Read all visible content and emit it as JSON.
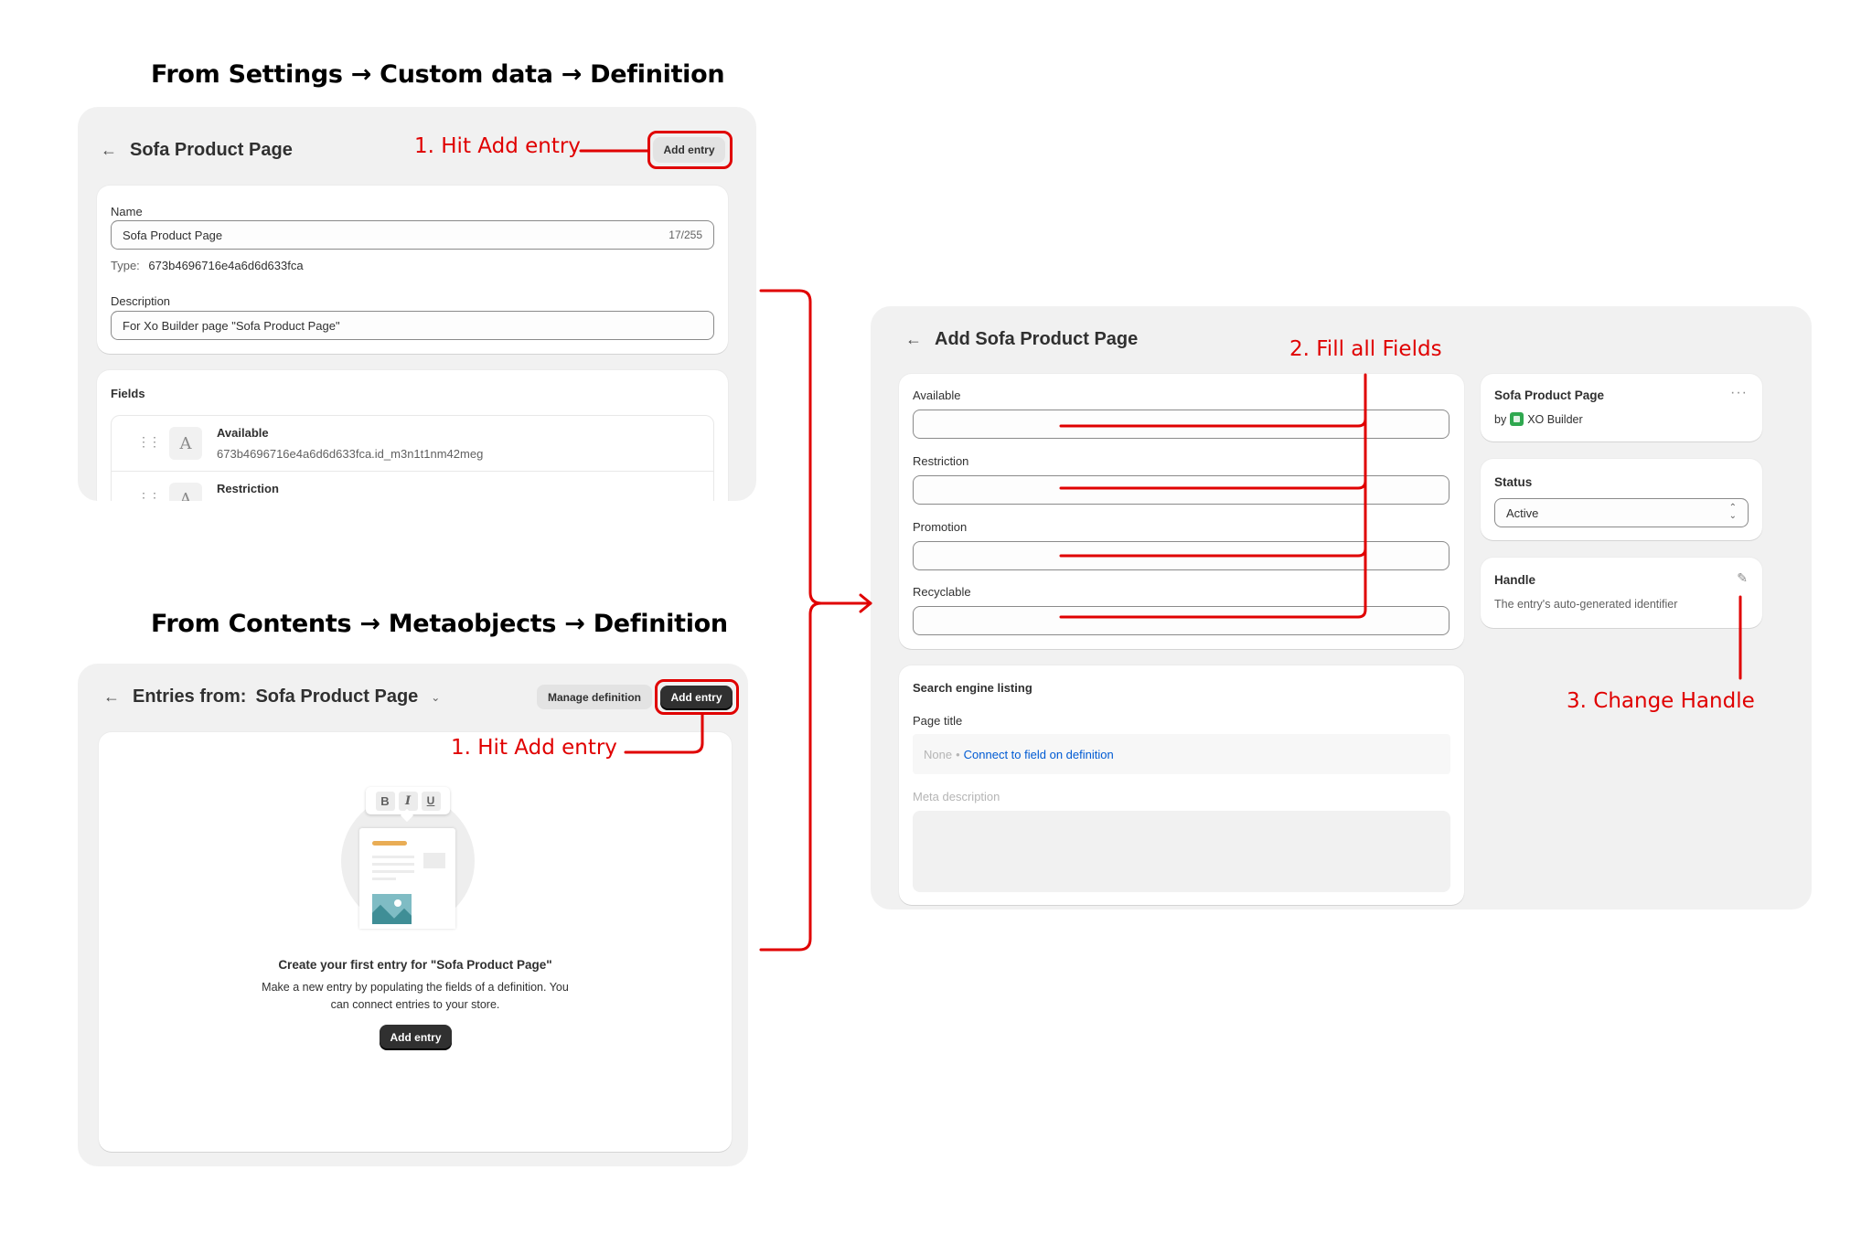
{
  "section1": {
    "heading": "From Settings → Custom data → Definition",
    "title": "Sofa Product Page",
    "add_entry_label": "Add entry",
    "annotation": "1. Hit Add entry",
    "name_label": "Name",
    "name_value": "Sofa Product Page",
    "name_counter": "17/255",
    "type_label": "Type:",
    "type_value": "673b4696716e4a6d6d633fca",
    "description_label": "Description",
    "description_value": "For Xo Builder page \"Sofa Product Page\"",
    "fields_heading": "Fields",
    "fields": [
      {
        "name": "Available",
        "key": "673b4696716e4a6d6d633fca.id_m3n1t1nm42meg",
        "icon": "A"
      },
      {
        "name": "Restriction",
        "key": "",
        "icon": "A"
      }
    ]
  },
  "section2": {
    "heading": "From Contents → Metaobjects → Definition",
    "title_prefix": "Entries from:",
    "title": "Sofa Product Page",
    "manage_definition_label": "Manage definition",
    "add_entry_label": "Add entry",
    "annotation": "1. Hit Add entry",
    "illustration_format_buttons": [
      "B",
      "I",
      "U"
    ],
    "empty_title": "Create your first entry for \"Sofa Product Page\"",
    "empty_desc_line1": "Make a new entry by populating the fields of a definition. You",
    "empty_desc_line2": "can connect entries to your store.",
    "empty_add_entry_label": "Add entry"
  },
  "section3": {
    "title": "Add Sofa Product Page",
    "annotation_fill": "2. Fill all Fields",
    "annotation_handle": "3. Change Handle",
    "fields": [
      {
        "label": "Available",
        "value": ""
      },
      {
        "label": "Restriction",
        "value": ""
      },
      {
        "label": "Promotion",
        "value": ""
      },
      {
        "label": "Recyclable",
        "value": ""
      }
    ],
    "seo": {
      "heading": "Search engine listing",
      "page_title_label": "Page title",
      "page_title_none": "None",
      "page_title_link": "Connect to field on definition",
      "meta_description_label": "Meta description"
    },
    "sidebar": {
      "definition_name": "Sofa Product Page",
      "by_label": "by",
      "app_name": "XO Builder",
      "more_icon": "···",
      "status_heading": "Status",
      "status_value": "Active",
      "handle_heading": "Handle",
      "handle_desc": "The entry's auto-generated identifier"
    }
  },
  "colors": {
    "annotation_red": "#e00000",
    "link_blue": "#005bd3",
    "panel_bg": "#f1f1f1",
    "app_icon_green": "#2fa84f"
  }
}
